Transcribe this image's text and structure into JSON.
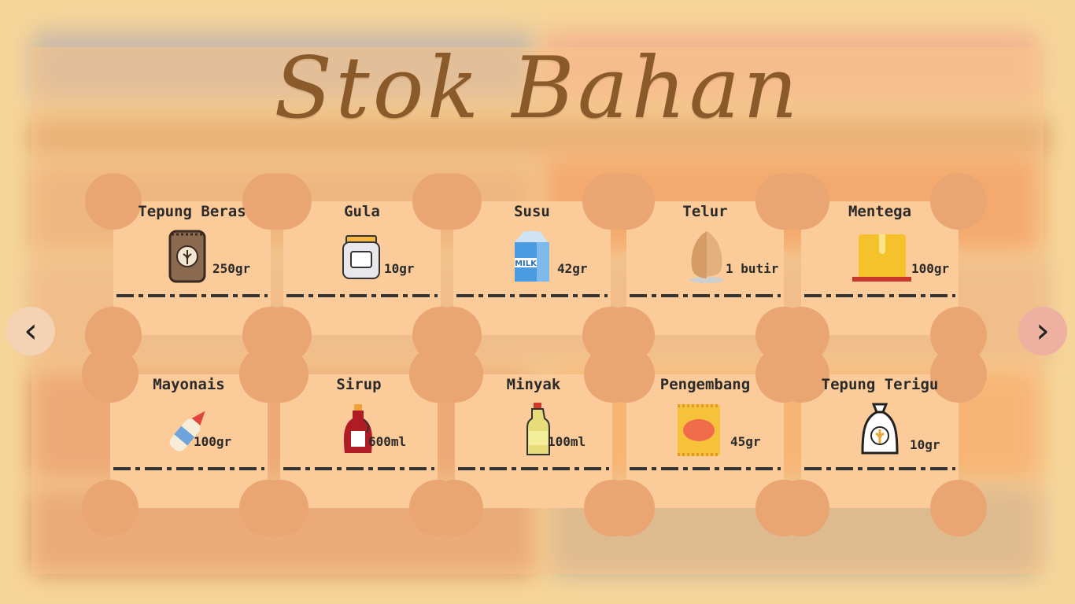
{
  "title": "Stok Bahan",
  "nav": {
    "prev_icon": "chevron-left-icon",
    "prev_glyph": "‹",
    "next_icon": "chevron-right-icon",
    "next_glyph": "›"
  },
  "items": [
    {
      "name": "Tepung Beras",
      "qty": "250gr",
      "icon": "flour-sack-icon"
    },
    {
      "name": "Gula",
      "qty": "10gr",
      "icon": "sugar-jar-icon"
    },
    {
      "name": "Susu",
      "qty": "42gr",
      "icon": "milk-carton-icon"
    },
    {
      "name": "Telur",
      "qty": "1 butir",
      "icon": "egg-icon"
    },
    {
      "name": "Mentega",
      "qty": "100gr",
      "icon": "butter-icon"
    },
    {
      "name": "Mayonais",
      "qty": "100gr",
      "icon": "mayo-bottle-icon"
    },
    {
      "name": "Sirup",
      "qty": "600ml",
      "icon": "syrup-bottle-icon"
    },
    {
      "name": "Minyak",
      "qty": "100ml",
      "icon": "oil-bottle-icon"
    },
    {
      "name": "Pengembang",
      "qty": "45gr",
      "icon": "baking-powder-icon"
    },
    {
      "name": "Tepung Terigu",
      "qty": "10gr",
      "icon": "wheat-flour-bag-icon"
    }
  ]
}
